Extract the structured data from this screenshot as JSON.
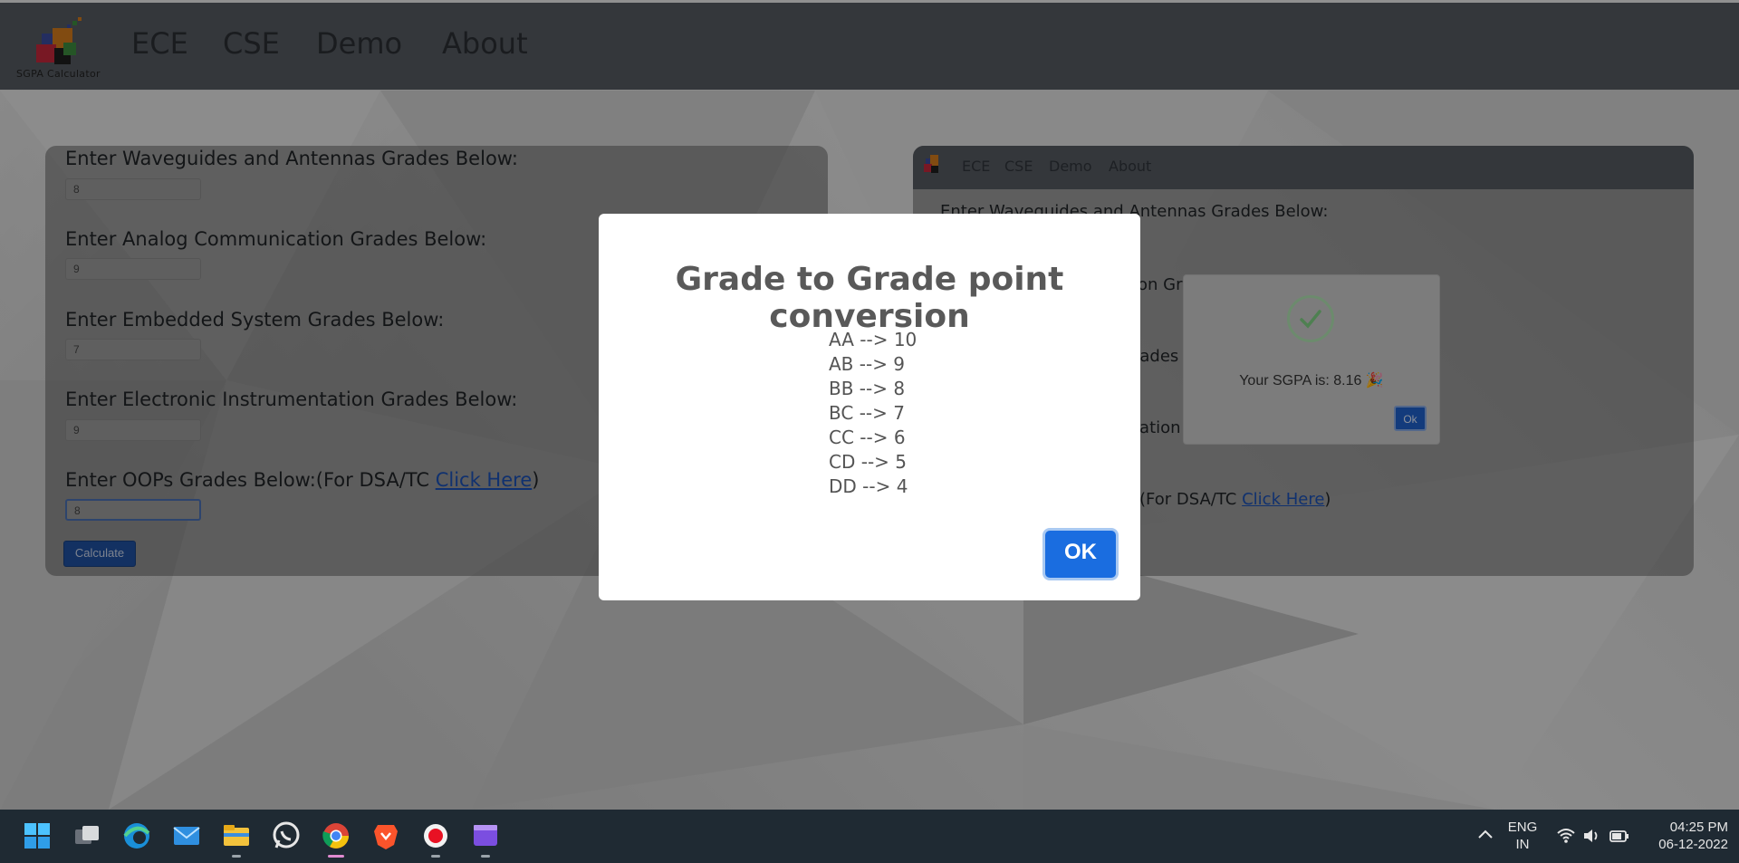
{
  "navbar": {
    "logo_caption": "SGPA Calculator",
    "links": [
      "ECE",
      "CSE",
      "Demo",
      "About"
    ]
  },
  "form": {
    "fields": [
      {
        "label": "Enter Waveguides and Antennas Grades Below:",
        "value": "8"
      },
      {
        "label": "Enter Analog Communication Grades Below:",
        "value": "9"
      },
      {
        "label": "Enter Embedded System Grades Below:",
        "value": "7"
      },
      {
        "label": "Enter Electronic Instrumentation Grades Below:",
        "value": "9"
      },
      {
        "label_prefix": "Enter OOPs Grades Below:(For DSA/TC ",
        "link": "Click Here",
        "label_suffix": ")",
        "value": "8"
      }
    ],
    "calculate_label": "Calculate"
  },
  "preview": {
    "links": [
      "ECE",
      "CSE",
      "Demo",
      "About"
    ],
    "heading": "Enter Waveguides and Antennas Grades Below:",
    "partial_1": "ion Gr",
    "partial_2": "rades",
    "partial_3": "tation",
    "partial_4_prefix": "(For DSA/TC ",
    "partial_4_link": "Click Here",
    "partial_4_suffix": ")",
    "result_message": "Your SGPA is: 8.16 🎉",
    "result_ok": "Ok"
  },
  "modal": {
    "title": "Grade to Grade point conversion",
    "conversions": [
      "AA --> 10",
      "AB --> 9",
      "BB --> 8",
      "BC --> 7",
      "CC --> 6",
      "CD --> 5",
      "DD --> 4"
    ],
    "ok_label": "OK"
  },
  "taskbar": {
    "apps": [
      "start-icon",
      "task-view-icon",
      "edge-icon",
      "mail-icon",
      "file-explorer-icon",
      "whatsapp-icon",
      "chrome-icon",
      "brave-icon",
      "recorder-icon",
      "clipchamp-icon"
    ],
    "language_line1": "ENG",
    "language_line2": "IN",
    "time": "04:25 PM",
    "date": "06-12-2022"
  }
}
